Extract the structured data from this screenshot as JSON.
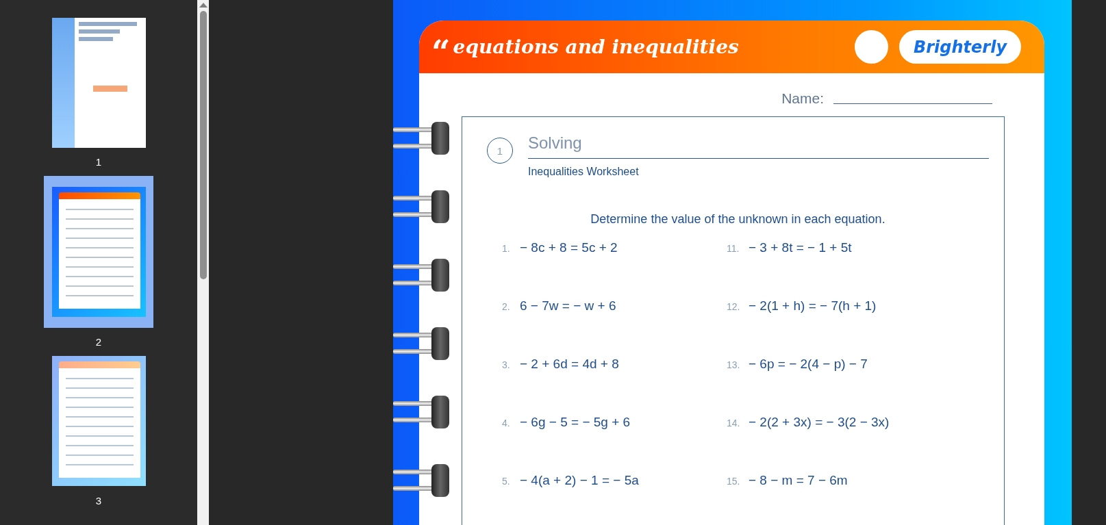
{
  "sidebar": {
    "thumbnails": [
      {
        "page": "1",
        "kind": "cover",
        "selected": false
      },
      {
        "page": "2",
        "kind": "worksheet",
        "selected": true
      },
      {
        "page": "3",
        "kind": "worksheet",
        "selected": false
      }
    ]
  },
  "document": {
    "header": {
      "quote_mark": "“",
      "title": "equations and inequalities",
      "logo": "Brighterly"
    },
    "name_label": "Name:",
    "section": {
      "number": "1",
      "title": "Solving",
      "subtitle": "Inequalities Worksheet"
    },
    "instruction": "Determine the value of the unknown in each equation.",
    "problems": [
      {
        "number": "1.",
        "equation": "− 8c + 8 = 5c + 2"
      },
      {
        "number": "11.",
        "equation": "− 3 + 8t = − 1 + 5t"
      },
      {
        "number": "2.",
        "equation": "6 − 7w = − w + 6"
      },
      {
        "number": "12.",
        "equation": "− 2(1 + h) = − 7(h + 1)"
      },
      {
        "number": "3.",
        "equation": "− 2 + 6d = 4d + 8"
      },
      {
        "number": "13.",
        "equation": "− 6p = − 2(4 − p) − 7"
      },
      {
        "number": "4.",
        "equation": "− 6g − 5 = − 5g + 6"
      },
      {
        "number": "14.",
        "equation": "− 2(2 + 3x) = − 3(2 − 3x)"
      },
      {
        "number": "5.",
        "equation": "− 4(a + 2) − 1 = − 5a"
      },
      {
        "number": "15.",
        "equation": "− 8 − m = 7 − 6m"
      }
    ]
  }
}
